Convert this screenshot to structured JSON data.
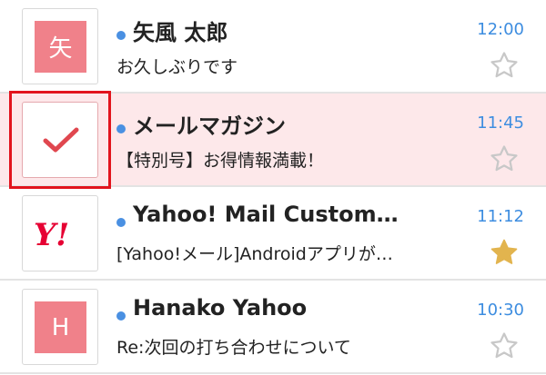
{
  "emails": [
    {
      "avatar_letter": "矢",
      "sender": "矢風 太郎",
      "subject": "お久しぶりです",
      "time": "12:00",
      "unread": true,
      "starred": false,
      "selected": false
    },
    {
      "avatar_letter": "",
      "sender": "メールマガジン",
      "subject": "【特別号】お得情報満載！",
      "time": "11:45",
      "unread": true,
      "starred": false,
      "selected": true
    },
    {
      "avatar_letter": "Y!",
      "sender": "Yahoo! Mail Custom…",
      "subject": "[Yahoo!メール]Androidアプリが…",
      "time": "11:12",
      "unread": true,
      "starred": true,
      "selected": false
    },
    {
      "avatar_letter": "H",
      "sender": "Hanako Yahoo",
      "subject": "Re:次回の打ち合わせについて",
      "time": "10:30",
      "unread": true,
      "starred": false,
      "selected": false
    }
  ],
  "colors": {
    "accent_blue": "#4a90e2",
    "avatar_pink": "#f0818a",
    "selected_bg": "#fde8ea",
    "selection_outline": "#e2141d",
    "star_filled": "#e2b44e",
    "star_empty": "#c8c8c8",
    "yahoo_red": "#e60033"
  }
}
